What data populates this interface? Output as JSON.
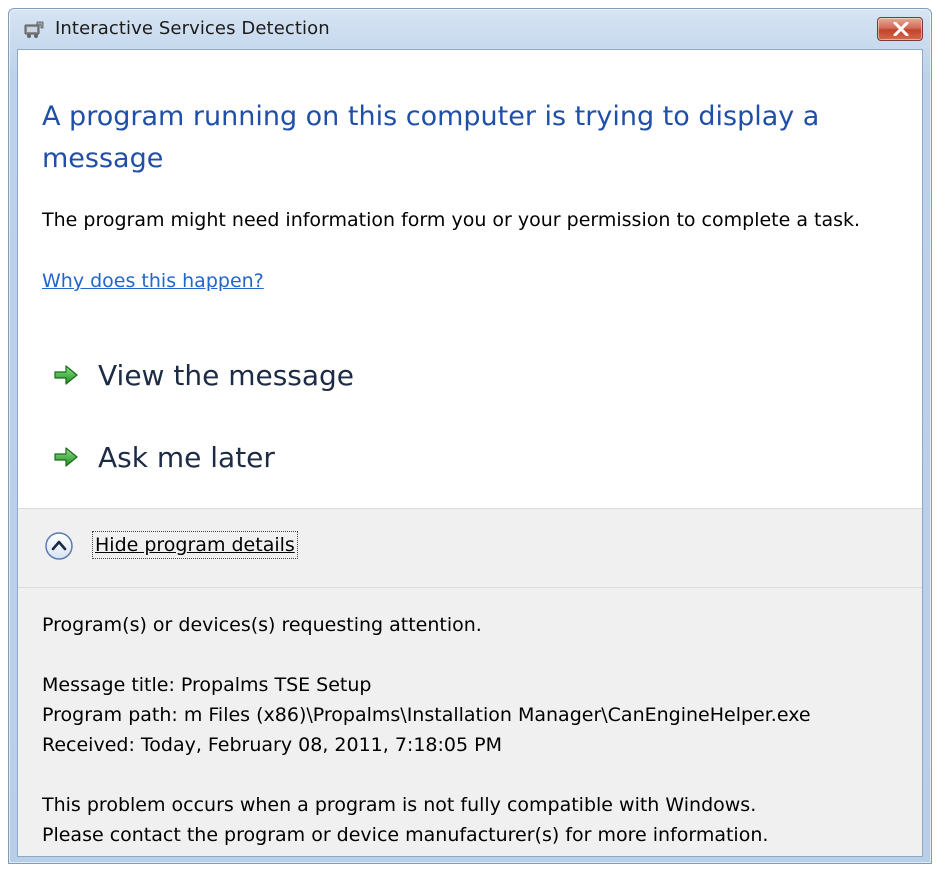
{
  "window": {
    "title": "Interactive Services Detection",
    "close_label": "Close"
  },
  "main": {
    "instruction": "A program running on this computer is trying to display a message",
    "content": "The program might need information form you or your permission to complete a task.",
    "help_link": "Why does this happen?"
  },
  "commands": [
    {
      "label": "View the message"
    },
    {
      "label": "Ask me later"
    }
  ],
  "details_toggle": {
    "label": "Hide program details",
    "expanded": true
  },
  "details": {
    "requesting": "Program(s) or devices(s) requesting attention.",
    "message_title": "Message title:  Propalms TSE Setup",
    "program_path": "Program path:  m Files (x86)\\Propalms\\Installation Manager\\CanEngineHelper.exe",
    "received": "Received:  Today, February 08, 2011, 7:18:05 PM",
    "problem_line1": "This problem occurs when a program is not fully compatible with Windows.",
    "problem_line2": "Please contact the program or device manufacturer(s) for more information."
  },
  "colors": {
    "instruction_blue": "#1f4fa8",
    "link_blue": "#2266cc",
    "arrow_green": "#2ca02c",
    "close_red": "#c2432b",
    "details_gray": "#f0f0f0"
  },
  "icons": {
    "title": "interactive-services-icon",
    "close": "close-icon",
    "command": "green-arrow-icon",
    "toggle": "chevron-up-icon"
  }
}
